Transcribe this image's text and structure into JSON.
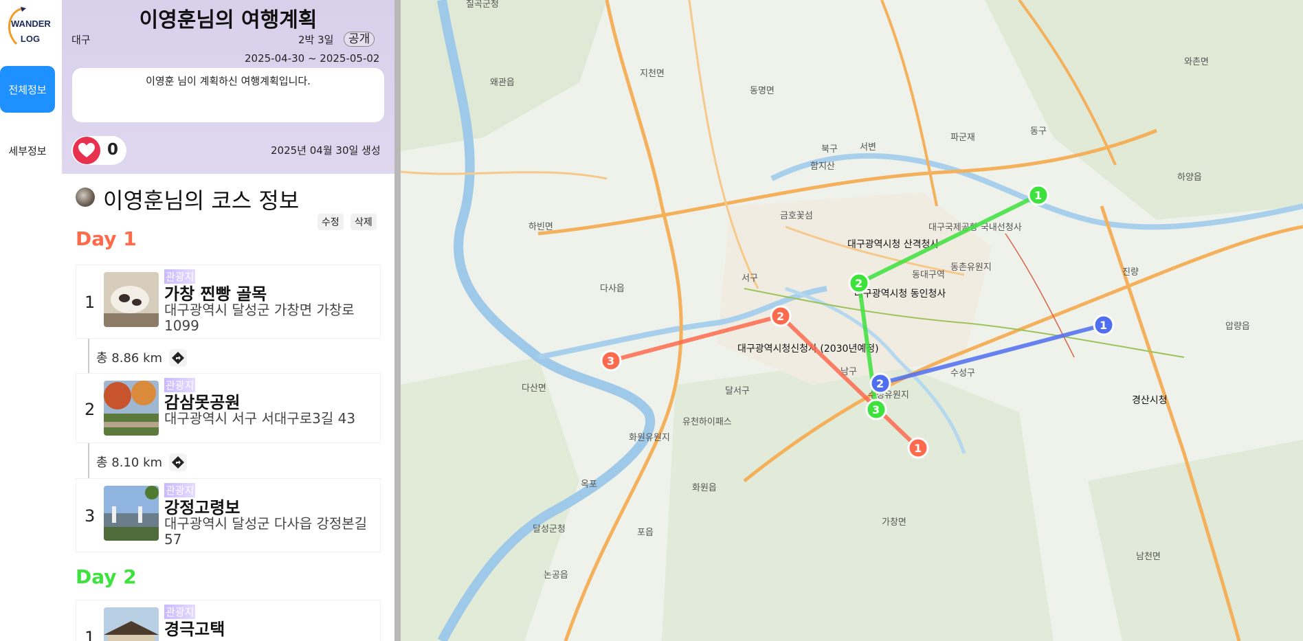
{
  "app": {
    "logo_line1": "WANDER",
    "logo_line2": "LOG"
  },
  "nav": {
    "overview_label": "전체정보",
    "detail_label": "세부정보"
  },
  "plan": {
    "title": "이영훈님의 여행계획",
    "region": "대구",
    "duration": "2박 3일",
    "visibility": "공개",
    "dates": "2025-04-30 ~ 2025-05-02",
    "description": "이영훈 님이 계획하신 여행계획입니다.",
    "likes": "0",
    "created": "2025년 04월 30일 생성"
  },
  "course": {
    "title": "이영훈님의 코스 정보",
    "edit_label": "수정",
    "delete_label": "삭제",
    "days": [
      {
        "label": "Day 1",
        "color": "#ff6a4a",
        "places": [
          {
            "num": "1",
            "category": "관광지",
            "name": "가창 찐빵 골목",
            "address": "대구광역시 달성군 가창면 가창로 1099"
          },
          {
            "num": "2",
            "category": "관광지",
            "name": "감삼못공원",
            "address": "대구광역시 서구 서대구로3길 43"
          },
          {
            "num": "3",
            "category": "관광지",
            "name": "강정고령보",
            "address": "대구광역시 달성군 다사읍 강정본길 57"
          }
        ],
        "distances": [
          "총 8.86 km",
          "총 8.10 km"
        ]
      },
      {
        "label": "Day 2",
        "color": "#3de23d",
        "places": [
          {
            "num": "1",
            "category": "관광지",
            "name": "경극고택",
            "address": ""
          }
        ],
        "distances": []
      }
    ]
  },
  "map": {
    "labels": {
      "l1": "칠곡군청",
      "l2": "왜관읍",
      "l3": "지천면",
      "l4": "동명면",
      "l5": "북구",
      "l6": "함지산",
      "l7": "서변",
      "l8": "파군재",
      "l9": "동구",
      "l10": "와촌면",
      "l11": "하양읍",
      "l12": "하빈면",
      "l13": "대구광역시청 산격청사",
      "l14": "대구국제공항 국내선청사",
      "l15": "대구광역시청 동인청사",
      "l16": "동대구역",
      "l17": "다사읍",
      "l18": "서구",
      "l19": "대구광역시청신청사 (2030년예정)",
      "l20": "압량읍",
      "l21": "다산면",
      "l22": "남구",
      "l23": "수성구",
      "l24": "수성유원지",
      "l25": "경산시청",
      "l26": "달서구",
      "l27": "유천하이패스",
      "l28": "화원유원지",
      "l29": "화원읍",
      "l30": "가창면",
      "l31": "달성군청",
      "l32": "논공읍",
      "l33": "남천면",
      "l34": "옥포",
      "l35": "포읍",
      "l36": "동촌유원지",
      "l37": "진량",
      "l38": "금호꽃섬"
    },
    "route_colors": {
      "day1": "#ff6a4a",
      "day2": "#3de23d",
      "day3": "#4f6ef0"
    }
  }
}
